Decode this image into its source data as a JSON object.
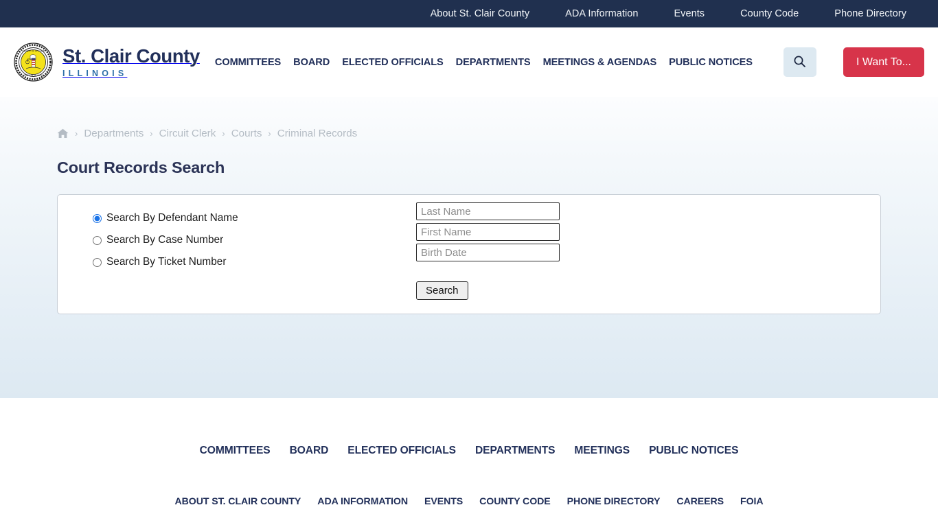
{
  "theme": {
    "navy": "#20304f",
    "brand_navy": "#22305a",
    "brand_blue": "#2d6fa8",
    "accent_red": "#d7344a",
    "search_btn_bg": "#dde9f1",
    "radio_accent": "#1a73e8",
    "band_gradient_top": "#fcfdfe",
    "band_gradient_bottom": "#dde9f2"
  },
  "topbar": {
    "links": [
      {
        "label": "About St. Clair County"
      },
      {
        "label": "ADA Information"
      },
      {
        "label": "Events"
      },
      {
        "label": "County Code"
      },
      {
        "label": "Phone Directory"
      }
    ]
  },
  "brand": {
    "title": "St. Clair County",
    "subtitle": "ILLINOIS",
    "seal_alt": "County of St. Clair State of Illinois seal",
    "seal_outer_text_top": "COUNTY OF ST CLAIR",
    "seal_outer_text_bottom": "STATE OF ILLINOIS"
  },
  "mainnav": {
    "links": [
      {
        "label": "COMMITTEES"
      },
      {
        "label": "BOARD"
      },
      {
        "label": "ELECTED OFFICIALS"
      },
      {
        "label": "DEPARTMENTS"
      },
      {
        "label": "MEETINGS & AGENDAS"
      },
      {
        "label": "PUBLIC NOTICES"
      }
    ]
  },
  "header_actions": {
    "search_icon": "search-icon",
    "i_want_to_label": "I Want To..."
  },
  "breadcrumb": {
    "home_icon": "home-icon",
    "separator": "›",
    "items": [
      {
        "label": "Departments"
      },
      {
        "label": "Circuit Clerk"
      },
      {
        "label": "Courts"
      },
      {
        "label": "Criminal Records"
      }
    ]
  },
  "main": {
    "page_title": "Court Records Search",
    "search_options": [
      {
        "label": "Search By Defendant Name",
        "value": "defendant",
        "checked": true
      },
      {
        "label": "Search By Case Number",
        "value": "case",
        "checked": false
      },
      {
        "label": "Search By Ticket Number",
        "value": "ticket",
        "checked": false
      }
    ],
    "fields": [
      {
        "name": "last-name",
        "placeholder": "Last Name",
        "value": ""
      },
      {
        "name": "first-name",
        "placeholder": "First Name",
        "value": ""
      },
      {
        "name": "birth-date",
        "placeholder": "Birth Date",
        "value": ""
      }
    ],
    "submit_label": "Search"
  },
  "footer": {
    "primary_links": [
      {
        "label": "COMMITTEES"
      },
      {
        "label": "BOARD"
      },
      {
        "label": "ELECTED OFFICIALS"
      },
      {
        "label": "DEPARTMENTS"
      },
      {
        "label": "MEETINGS"
      },
      {
        "label": "PUBLIC NOTICES"
      }
    ],
    "secondary_links": [
      {
        "label": "ABOUT ST. CLAIR COUNTY"
      },
      {
        "label": "ADA INFORMATION"
      },
      {
        "label": "EVENTS"
      },
      {
        "label": "COUNTY CODE"
      },
      {
        "label": "PHONE DIRECTORY"
      },
      {
        "label": "CAREERS"
      },
      {
        "label": "FOIA"
      }
    ]
  }
}
